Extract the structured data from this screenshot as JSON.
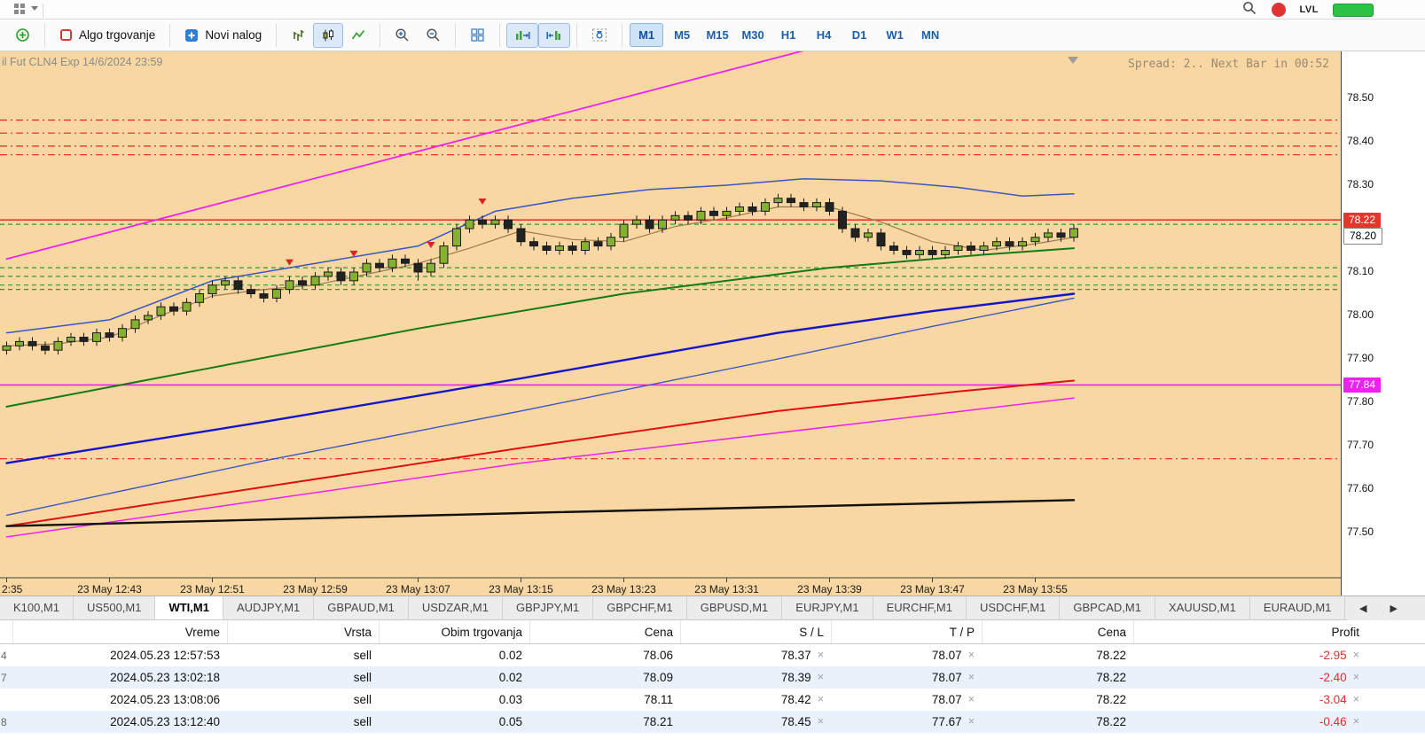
{
  "topbar": {
    "lvl_label": "LVL"
  },
  "toolbar": {
    "algo_label": "Algo trgovanje",
    "new_order_label": "Novi nalog",
    "timeframes": [
      "M1",
      "M5",
      "M15",
      "M30",
      "H1",
      "H4",
      "D1",
      "W1",
      "MN"
    ],
    "active_timeframe": "M1"
  },
  "chart": {
    "title": "il Fut CLN4 Exp 14/6/2024 23:59",
    "status": "Spread: 2.. Next Bar in 00:52",
    "bg": "#f9d7a2"
  },
  "chart_data": {
    "type": "candlestick",
    "symbol": "WTI",
    "timeframe": "M1",
    "up_color": "#86b02f",
    "down_color": "#222222",
    "y_ticks": [
      78.5,
      78.4,
      78.3,
      78.1,
      78.0,
      77.9,
      77.8,
      77.7,
      77.6,
      77.5
    ],
    "x_ticks": [
      {
        "idx": 0,
        "label": "2:35",
        "align": "left"
      },
      {
        "idx": 8,
        "label": "23 May 12:43"
      },
      {
        "idx": 16,
        "label": "23 May 12:51"
      },
      {
        "idx": 24,
        "label": "23 May 12:59"
      },
      {
        "idx": 32,
        "label": "23 May 13:07"
      },
      {
        "idx": 40,
        "label": "23 May 13:15"
      },
      {
        "idx": 48,
        "label": "23 May 13:23"
      },
      {
        "idx": 56,
        "label": "23 May 13:31"
      },
      {
        "idx": 64,
        "label": "23 May 13:39"
      },
      {
        "idx": 72,
        "label": "23 May 13:47"
      },
      {
        "idx": 80,
        "label": "23 May 13:55"
      }
    ],
    "candles": [
      [
        77.92,
        77.94,
        77.91,
        77.93
      ],
      [
        77.93,
        77.95,
        77.92,
        77.94
      ],
      [
        77.94,
        77.95,
        77.92,
        77.93
      ],
      [
        77.93,
        77.94,
        77.91,
        77.92
      ],
      [
        77.92,
        77.95,
        77.91,
        77.94
      ],
      [
        77.94,
        77.96,
        77.93,
        77.95
      ],
      [
        77.95,
        77.96,
        77.93,
        77.94
      ],
      [
        77.94,
        77.97,
        77.93,
        77.96
      ],
      [
        77.96,
        77.97,
        77.94,
        77.95
      ],
      [
        77.95,
        77.98,
        77.94,
        77.97
      ],
      [
        77.97,
        78.0,
        77.96,
        77.99
      ],
      [
        77.99,
        78.01,
        77.98,
        78.0
      ],
      [
        78.0,
        78.03,
        77.99,
        78.02
      ],
      [
        78.02,
        78.03,
        78.0,
        78.01
      ],
      [
        78.01,
        78.04,
        78.0,
        78.03
      ],
      [
        78.03,
        78.06,
        78.02,
        78.05
      ],
      [
        78.05,
        78.08,
        78.04,
        78.07
      ],
      [
        78.07,
        78.09,
        78.06,
        78.08
      ],
      [
        78.08,
        78.09,
        78.05,
        78.06
      ],
      [
        78.06,
        78.07,
        78.04,
        78.05
      ],
      [
        78.05,
        78.06,
        78.03,
        78.04
      ],
      [
        78.04,
        78.07,
        78.03,
        78.06
      ],
      [
        78.06,
        78.09,
        78.05,
        78.08
      ],
      [
        78.08,
        78.09,
        78.06,
        78.07
      ],
      [
        78.07,
        78.1,
        78.06,
        78.09
      ],
      [
        78.09,
        78.11,
        78.08,
        78.1
      ],
      [
        78.1,
        78.11,
        78.07,
        78.08
      ],
      [
        78.08,
        78.11,
        78.07,
        78.1
      ],
      [
        78.1,
        78.13,
        78.09,
        78.12
      ],
      [
        78.12,
        78.13,
        78.1,
        78.11
      ],
      [
        78.11,
        78.14,
        78.1,
        78.13
      ],
      [
        78.13,
        78.14,
        78.11,
        78.12
      ],
      [
        78.12,
        78.13,
        78.08,
        78.1
      ],
      [
        78.1,
        78.13,
        78.09,
        78.12
      ],
      [
        78.12,
        78.17,
        78.11,
        78.16
      ],
      [
        78.16,
        78.21,
        78.15,
        78.2
      ],
      [
        78.2,
        78.23,
        78.19,
        78.22
      ],
      [
        78.22,
        78.23,
        78.2,
        78.21
      ],
      [
        78.21,
        78.23,
        78.2,
        78.22
      ],
      [
        78.22,
        78.23,
        78.19,
        78.2
      ],
      [
        78.2,
        78.21,
        78.16,
        78.17
      ],
      [
        78.17,
        78.18,
        78.15,
        78.16
      ],
      [
        78.16,
        78.17,
        78.14,
        78.15
      ],
      [
        78.15,
        78.17,
        78.14,
        78.16
      ],
      [
        78.16,
        78.17,
        78.14,
        78.15
      ],
      [
        78.15,
        78.18,
        78.14,
        78.17
      ],
      [
        78.17,
        78.18,
        78.15,
        78.16
      ],
      [
        78.16,
        78.19,
        78.15,
        78.18
      ],
      [
        78.18,
        78.22,
        78.17,
        78.21
      ],
      [
        78.21,
        78.23,
        78.2,
        78.22
      ],
      [
        78.22,
        78.23,
        78.19,
        78.2
      ],
      [
        78.2,
        78.23,
        78.19,
        78.22
      ],
      [
        78.22,
        78.24,
        78.21,
        78.23
      ],
      [
        78.23,
        78.24,
        78.21,
        78.22
      ],
      [
        78.22,
        78.25,
        78.21,
        78.24
      ],
      [
        78.24,
        78.25,
        78.22,
        78.23
      ],
      [
        78.23,
        78.25,
        78.22,
        78.24
      ],
      [
        78.24,
        78.26,
        78.23,
        78.25
      ],
      [
        78.25,
        78.26,
        78.23,
        78.24
      ],
      [
        78.24,
        78.27,
        78.23,
        78.26
      ],
      [
        78.26,
        78.28,
        78.25,
        78.27
      ],
      [
        78.27,
        78.28,
        78.25,
        78.26
      ],
      [
        78.26,
        78.27,
        78.24,
        78.25
      ],
      [
        78.25,
        78.27,
        78.24,
        78.26
      ],
      [
        78.26,
        78.27,
        78.23,
        78.24
      ],
      [
        78.24,
        78.25,
        78.19,
        78.2
      ],
      [
        78.2,
        78.21,
        78.17,
        78.18
      ],
      [
        78.18,
        78.2,
        78.17,
        78.19
      ],
      [
        78.19,
        78.2,
        78.15,
        78.16
      ],
      [
        78.16,
        78.17,
        78.14,
        78.15
      ],
      [
        78.15,
        78.16,
        78.13,
        78.14
      ],
      [
        78.14,
        78.16,
        78.13,
        78.15
      ],
      [
        78.15,
        78.16,
        78.13,
        78.14
      ],
      [
        78.14,
        78.16,
        78.13,
        78.15
      ],
      [
        78.15,
        78.17,
        78.14,
        78.16
      ],
      [
        78.16,
        78.17,
        78.14,
        78.15
      ],
      [
        78.15,
        78.17,
        78.14,
        78.16
      ],
      [
        78.16,
        78.18,
        78.15,
        78.17
      ],
      [
        78.17,
        78.18,
        78.15,
        78.16
      ],
      [
        78.16,
        78.18,
        78.15,
        78.17
      ],
      [
        78.17,
        78.19,
        78.16,
        78.18
      ],
      [
        78.18,
        78.2,
        78.17,
        78.19
      ],
      [
        78.19,
        78.2,
        78.17,
        78.18
      ],
      [
        78.18,
        78.21,
        78.17,
        78.2
      ]
    ],
    "levels": [
      {
        "price": 78.45,
        "color": "#ee2222",
        "style": "dashdot",
        "width": 1.2
      },
      {
        "price": 78.42,
        "color": "#ee2222",
        "style": "dashdot",
        "width": 1.2
      },
      {
        "price": 78.39,
        "color": "#ee2222",
        "style": "dashdot",
        "width": 1.2
      },
      {
        "price": 78.37,
        "color": "#ee2222",
        "style": "dashdot",
        "width": 1.2
      },
      {
        "price": 78.22,
        "color": "#ee3333",
        "style": "solid",
        "width": 1.6
      },
      {
        "price": 78.21,
        "color": "#22a022",
        "style": "dash",
        "width": 1.2
      },
      {
        "price": 78.11,
        "color": "#22a022",
        "style": "dash",
        "width": 1.2
      },
      {
        "price": 78.09,
        "color": "#22a022",
        "style": "dash",
        "width": 1.2
      },
      {
        "price": 78.07,
        "color": "#22a022",
        "style": "dash",
        "width": 1.2
      },
      {
        "price": 78.06,
        "color": "#22a022",
        "style": "dash",
        "width": 1.2
      },
      {
        "price": 77.84,
        "color": "#ee22ee",
        "style": "solid",
        "width": 1.6
      },
      {
        "price": 77.67,
        "color": "#ee2222",
        "style": "dashdot",
        "width": 1.2
      }
    ],
    "lines": [
      {
        "name": "channel-upper-magenta-line",
        "color": "#ee22ee",
        "width": 1.8,
        "points": [
          [
            0,
            78.13
          ],
          [
            20,
            78.285
          ],
          [
            40,
            78.44
          ],
          [
            62,
            78.61
          ]
        ]
      },
      {
        "name": "channel-lower-magenta-line",
        "color": "#ee22ee",
        "width": 1.5,
        "points": [
          [
            0,
            77.49
          ],
          [
            40,
            77.66
          ],
          [
            83,
            77.81
          ]
        ]
      },
      {
        "name": "upper-band-blue-line",
        "color": "#3a56c4",
        "width": 1.5,
        "points": [
          [
            0,
            77.96
          ],
          [
            8,
            77.99
          ],
          [
            16,
            78.08
          ],
          [
            24,
            78.12
          ],
          [
            32,
            78.16
          ],
          [
            38,
            78.24
          ],
          [
            44,
            78.27
          ],
          [
            50,
            78.29
          ],
          [
            56,
            78.3
          ],
          [
            62,
            78.315
          ],
          [
            68,
            78.31
          ],
          [
            74,
            78.295
          ],
          [
            79,
            78.275
          ],
          [
            83,
            78.28
          ]
        ]
      },
      {
        "name": "sma-blue-thick-line",
        "color": "#1414cc",
        "width": 2.4,
        "points": [
          [
            0,
            77.66
          ],
          [
            20,
            77.755
          ],
          [
            40,
            77.855
          ],
          [
            60,
            77.96
          ],
          [
            72,
            78.01
          ],
          [
            83,
            78.05
          ]
        ]
      },
      {
        "name": "sma-blue-thin-line",
        "color": "#3a56c4",
        "width": 1.4,
        "points": [
          [
            0,
            77.54
          ],
          [
            20,
            77.665
          ],
          [
            40,
            77.78
          ],
          [
            60,
            77.9
          ],
          [
            72,
            77.975
          ],
          [
            83,
            78.04
          ]
        ]
      },
      {
        "name": "ma-green-line",
        "color": "#157a15",
        "width": 2,
        "points": [
          [
            0,
            77.79
          ],
          [
            16,
            77.88
          ],
          [
            32,
            77.97
          ],
          [
            48,
            78.05
          ],
          [
            64,
            78.11
          ],
          [
            76,
            78.14
          ],
          [
            83,
            78.155
          ]
        ]
      },
      {
        "name": "ma-red-line",
        "color": "#dd1111",
        "width": 2,
        "points": [
          [
            0,
            77.515
          ],
          [
            20,
            77.605
          ],
          [
            40,
            77.695
          ],
          [
            60,
            77.78
          ],
          [
            74,
            77.825
          ],
          [
            83,
            77.85
          ]
        ]
      },
      {
        "name": "ma-black-line",
        "color": "#111111",
        "width": 2.4,
        "points": [
          [
            0,
            77.515
          ],
          [
            40,
            77.545
          ],
          [
            83,
            77.575
          ]
        ]
      },
      {
        "name": "ma-fast-olive-line",
        "color": "#9a7b4f",
        "width": 1.2,
        "points": [
          [
            0,
            77.93
          ],
          [
            4,
            77.935
          ],
          [
            8,
            77.95
          ],
          [
            12,
            78.0
          ],
          [
            16,
            78.045
          ],
          [
            20,
            78.06
          ],
          [
            24,
            78.07
          ],
          [
            28,
            78.095
          ],
          [
            32,
            78.12
          ],
          [
            36,
            78.155
          ],
          [
            40,
            78.195
          ],
          [
            44,
            78.175
          ],
          [
            48,
            78.17
          ],
          [
            52,
            78.205
          ],
          [
            56,
            78.225
          ],
          [
            60,
            78.25
          ],
          [
            64,
            78.25
          ],
          [
            68,
            78.215
          ],
          [
            72,
            78.17
          ],
          [
            76,
            78.15
          ],
          [
            80,
            78.165
          ],
          [
            83,
            78.18
          ]
        ]
      }
    ],
    "markers": [
      {
        "idx": 22,
        "price": 78.115,
        "type": "sell"
      },
      {
        "idx": 27,
        "price": 78.135,
        "type": "sell"
      },
      {
        "idx": 33,
        "price": 78.155,
        "type": "sell"
      },
      {
        "idx": 37,
        "price": 78.255,
        "type": "sell"
      }
    ],
    "badges": [
      {
        "price": 78.22,
        "label": "78.22",
        "bg": "#e8352c",
        "fg": "#ffffff",
        "dy": -8
      },
      {
        "price": 78.2,
        "label": "78.20",
        "bg": "#ffffff",
        "fg": "#000000",
        "border": "#888888",
        "dy": -1
      },
      {
        "price": 77.84,
        "label": "77.84",
        "bg": "#ee22ee",
        "fg": "#ffffff",
        "dy": -8
      }
    ]
  },
  "tabs": {
    "items": [
      "K100,M1",
      "US500,M1",
      "WTI,M1",
      "AUDJPY,M1",
      "GBPAUD,M1",
      "USDZAR,M1",
      "GBPJPY,M1",
      "GBPCHF,M1",
      "GBPUSD,M1",
      "EURJPY,M1",
      "EURCHF,M1",
      "USDCHF,M1",
      "GBPCAD,M1",
      "XAUUSD,M1",
      "EURAUD,M1"
    ],
    "active": "WTI,M1",
    "scroll_left": "◀",
    "scroll_right": "▶"
  },
  "table": {
    "close_glyph": "×",
    "order": [
      "ticket",
      "time",
      "type",
      "volume",
      "price",
      "sl",
      "tp",
      "current",
      "profit"
    ],
    "headers": {
      "ticket": "",
      "time": "Vreme",
      "type": "Vrsta",
      "volume": "Obim trgovanja",
      "price": "Cena",
      "sl": "S / L",
      "tp": "T / P",
      "current": "Cena",
      "profit": "Profit"
    },
    "rows": [
      {
        "ticket": "4",
        "time": "2024.05.23 12:57:53",
        "type": "sell",
        "volume": "0.02",
        "price": "78.06",
        "sl": "78.37",
        "tp": "78.07",
        "current": "78.22",
        "profit": "-2.95"
      },
      {
        "ticket": "7",
        "time": "2024.05.23 13:02:18",
        "type": "sell",
        "volume": "0.02",
        "price": "78.09",
        "sl": "78.39",
        "tp": "78.07",
        "current": "78.22",
        "profit": "-2.40"
      },
      {
        "ticket": "",
        "time": "2024.05.23 13:08:06",
        "type": "sell",
        "volume": "0.03",
        "price": "78.11",
        "sl": "78.42",
        "tp": "78.07",
        "current": "78.22",
        "profit": "-3.04"
      },
      {
        "ticket": "8",
        "time": "2024.05.23 13:12:40",
        "type": "sell",
        "volume": "0.05",
        "price": "78.21",
        "sl": "78.45",
        "tp": "77.67",
        "current": "78.22",
        "profit": "-0.46"
      }
    ]
  }
}
